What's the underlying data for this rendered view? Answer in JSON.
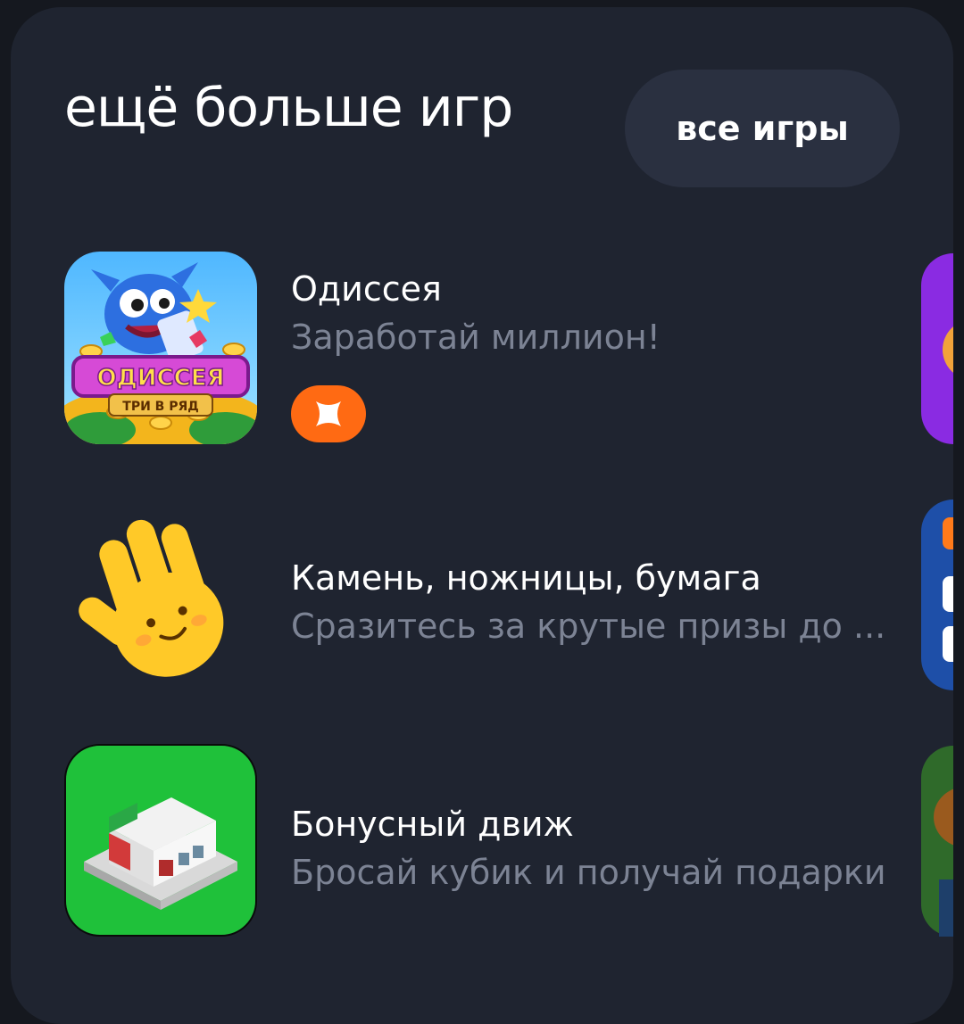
{
  "section": {
    "title": "ещё больше игр",
    "all_games_label": "все игры"
  },
  "games": [
    {
      "title": "Одиссея",
      "subtitle": "Заработай миллион!",
      "logo_text": "ОДИССЕЯ",
      "logo_subtext": "ТРИ В РЯД",
      "badge_icon": "x-logo-icon"
    },
    {
      "title": "Камень, ножницы, бумага",
      "subtitle": "Сразитесь за крутые призы до ..."
    },
    {
      "title": "Бонусный движ",
      "subtitle": "Бросай кубик и получай подарки"
    }
  ],
  "colors": {
    "card_bg": "#1f2430",
    "button_bg": "#2a3040",
    "badge_orange": "#ff6a13",
    "subtitle_gray": "#7c8394"
  }
}
